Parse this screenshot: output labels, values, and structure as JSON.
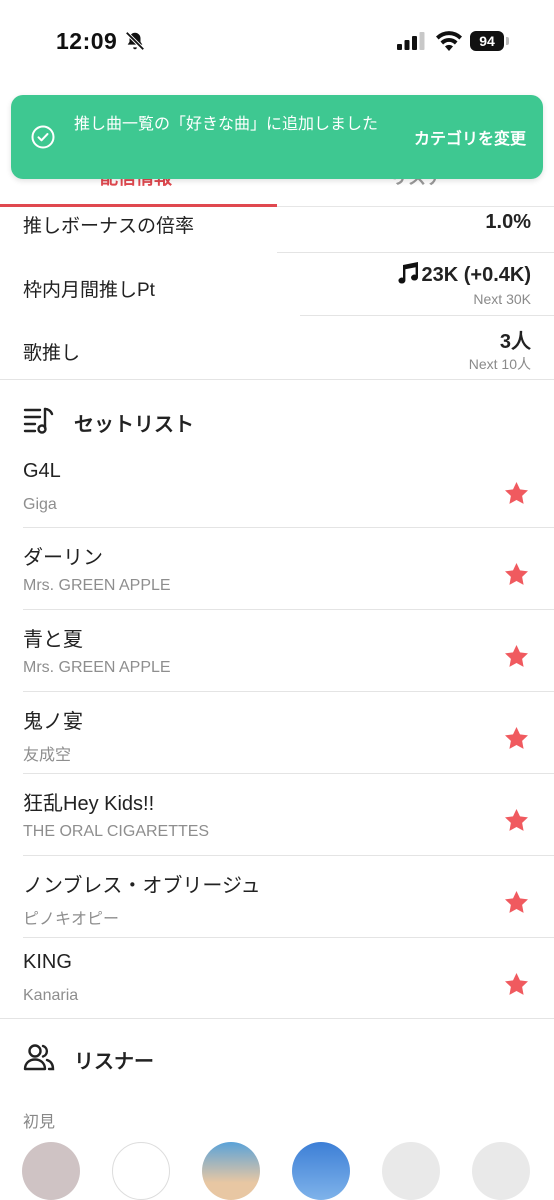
{
  "status_bar": {
    "time": "12:09",
    "battery": "94"
  },
  "tabs": {
    "left": "配信情報",
    "right": "リスナー"
  },
  "toast": {
    "message": "推し曲一覧の「好きな曲」に追加しました",
    "action": "カテゴリを変更"
  },
  "stats": [
    {
      "label": "推しボーナスの倍率",
      "value": "1.0%",
      "sub": ""
    },
    {
      "label": "枠内月間推しPt",
      "value": "23K (+0.4K)",
      "sub": "Next 30K",
      "value_icon": "music-note-icon"
    },
    {
      "label": "歌推し",
      "value": "3人",
      "sub": "Next 10人"
    }
  ],
  "setlist": {
    "title": "セットリスト",
    "icon": "music-list-icon",
    "songs": [
      {
        "title": "G4L",
        "artist": "Giga"
      },
      {
        "title": "ダーリン",
        "artist": "Mrs. GREEN APPLE"
      },
      {
        "title": "青と夏",
        "artist": "Mrs. GREEN APPLE"
      },
      {
        "title": "鬼ノ宴",
        "artist": "友成空"
      },
      {
        "title": "狂乱Hey Kids!!",
        "artist": "THE ORAL CIGARETTES"
      },
      {
        "title": "ノンブレス・オブリージュ",
        "artist": "ピノキオピー"
      },
      {
        "title": "KING",
        "artist": "Kanaria"
      }
    ]
  },
  "listeners": {
    "title": "リスナー",
    "icon": "users-icon",
    "first_time_label": "初見"
  },
  "colors": {
    "accent": "#e0484f",
    "toast": "#3ec891",
    "star": "#f05a5f"
  }
}
